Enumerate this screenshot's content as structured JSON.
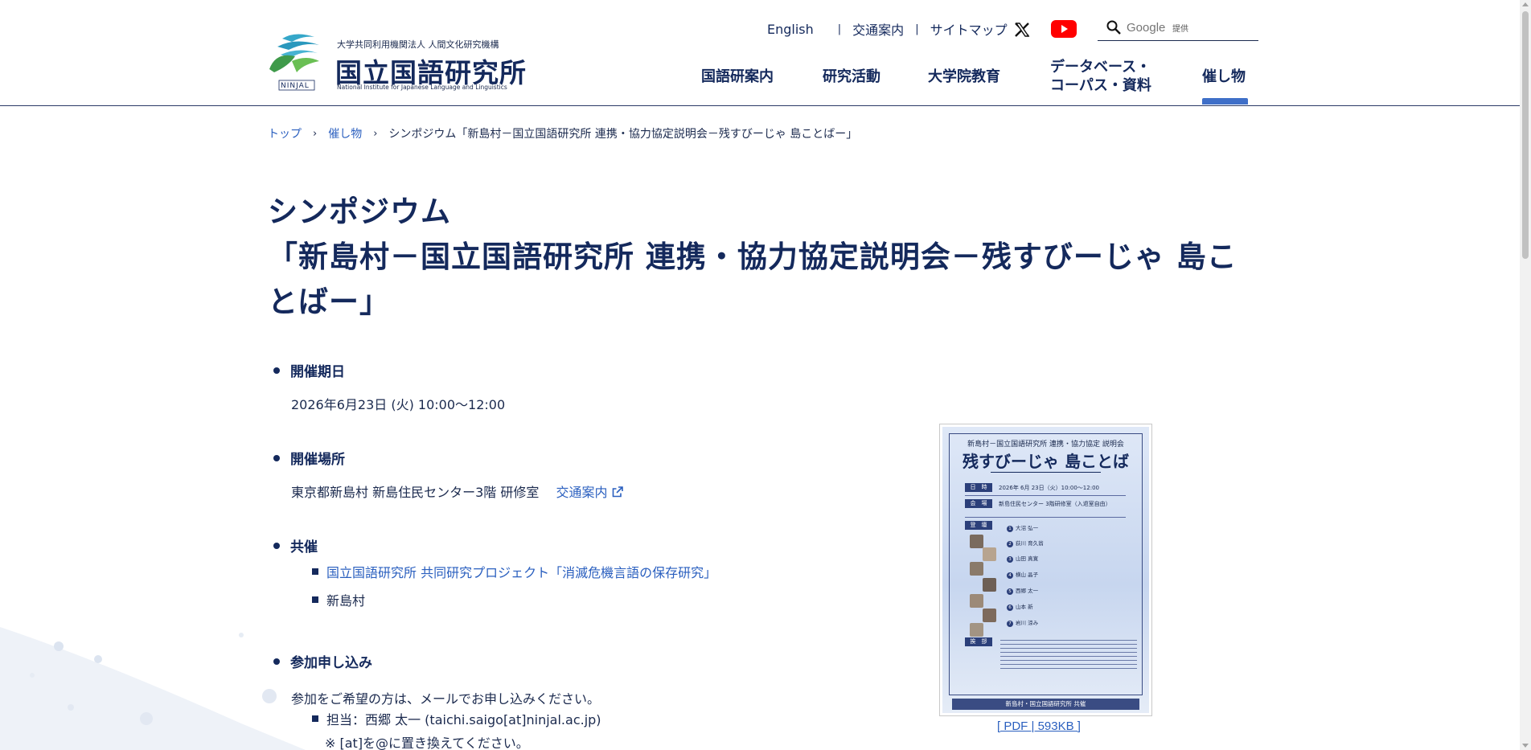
{
  "header": {
    "logo_sub": "大学共同利用機関法人 人間文化研究機構",
    "logo_main": "国立国語研究所",
    "logo_en": "National Institute for Japanese Language and Linguistics",
    "logo_mark_text": "NINJAL",
    "utility": [
      "English",
      "交通案内",
      "サイトマップ"
    ],
    "search_placeholder": "Google",
    "search_provider": "提供",
    "nav": [
      {
        "label": "国語研案内"
      },
      {
        "label": "研究活動"
      },
      {
        "label": "大学院教育"
      },
      {
        "label": "データベース・",
        "label2": "コーパス・資料"
      },
      {
        "label": "催し物",
        "active": true
      }
    ]
  },
  "breadcrumb": {
    "items": [
      "トップ",
      "催し物"
    ],
    "current": "シンポジウム「新島村－国立国語研究所 連携・協力協定説明会－残すびーじゃ 島ことばー」"
  },
  "title": {
    "line1": "シンポジウム",
    "line2": "「新島村－国立国語研究所 連携・協力協定説明会－残すびーじゃ 島こ",
    "line3": "とばー」"
  },
  "details": {
    "date_label": "開催期日",
    "date_value": "2026年6月23日 (火) 10:00〜12:00",
    "venue_label": "開催場所",
    "venue_value": "東京都新島村 新島住民センター3階 研修室",
    "venue_link": "交通案内",
    "cohost_label": "共催",
    "cohosts": [
      {
        "text": "国立国語研究所 共同研究プロジェクト「消滅危機言語の保存研究」",
        "link": true
      },
      {
        "text": "新島村",
        "link": false
      }
    ],
    "apply_label": "参加申し込み",
    "apply_text": "参加をご希望の方は、メールでお申し込みください。",
    "contact": "担当：西郷 太一 (taichi.saigo[at]ninjal.ac.jp)",
    "note": "※ [at]を@に置き換えてください。"
  },
  "poster": {
    "head": "新島村－国立国語研究所 連携・協力協定 説明会",
    "title": "残すびーじゃ 島ことば",
    "rows": [
      {
        "tag": "日　時",
        "text": "2026年 6月 23日（火）10:00～12:00"
      },
      {
        "tag": "会　場",
        "text": "新島住民センター 3階研修室（入退室自由）"
      },
      {
        "tag": "登　壇",
        "text": ""
      }
    ],
    "speakers": [
      "大沼 弘一",
      "荻川 育久翁",
      "山田 真寛",
      "横山 晶子",
      "西郷 太一",
      "山本 新",
      "岩川 涼み"
    ],
    "greeting_tag": "挨　拶",
    "footer": "新島村・国立国語研究所 共催",
    "caption": "[ PDF | 593KB ]"
  },
  "colors": {
    "navy": "#14295c",
    "link": "#2a5fbf",
    "active_bar": "#3f6fc8"
  }
}
